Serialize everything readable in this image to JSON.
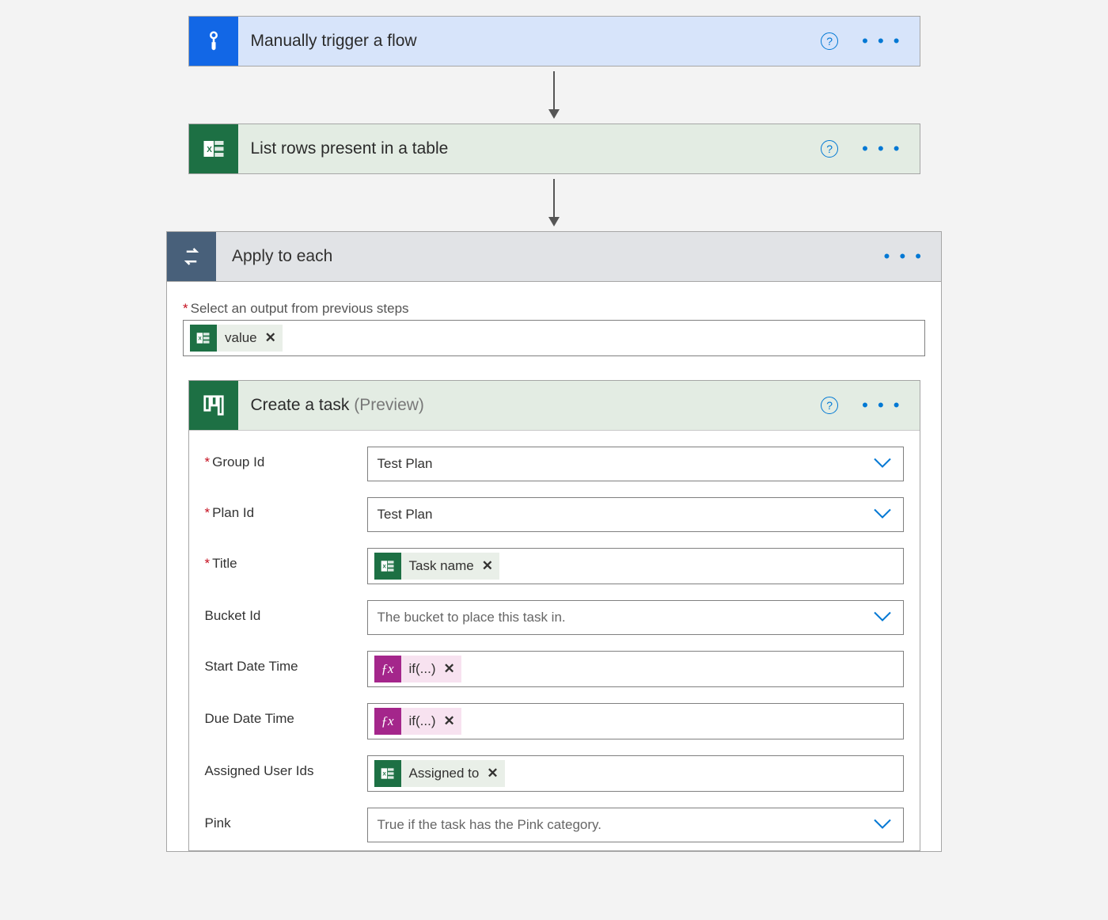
{
  "steps": {
    "trigger": {
      "title": "Manually trigger a flow"
    },
    "listRows": {
      "title": "List rows present in a table"
    },
    "applyEach": {
      "title": "Apply to each",
      "selectOutputLabel": "Select an output from previous steps",
      "valueToken": "value"
    },
    "createTask": {
      "title": "Create a task",
      "suffix": "(Preview)",
      "fields": {
        "groupId": {
          "label": "Group Id",
          "value": "Test Plan"
        },
        "planId": {
          "label": "Plan Id",
          "value": "Test Plan"
        },
        "title": {
          "label": "Title",
          "token": "Task name"
        },
        "bucketId": {
          "label": "Bucket Id",
          "placeholder": "The bucket to place this task in."
        },
        "startDate": {
          "label": "Start Date Time",
          "fx": "if(...)"
        },
        "dueDate": {
          "label": "Due Date Time",
          "fx": "if(...)"
        },
        "assigned": {
          "label": "Assigned User Ids",
          "token": "Assigned to"
        },
        "pink": {
          "label": "Pink",
          "placeholder": "True if the task has the Pink category."
        }
      }
    }
  },
  "glyphs": {
    "x": "✕",
    "help": "?",
    "more": "• • •"
  }
}
